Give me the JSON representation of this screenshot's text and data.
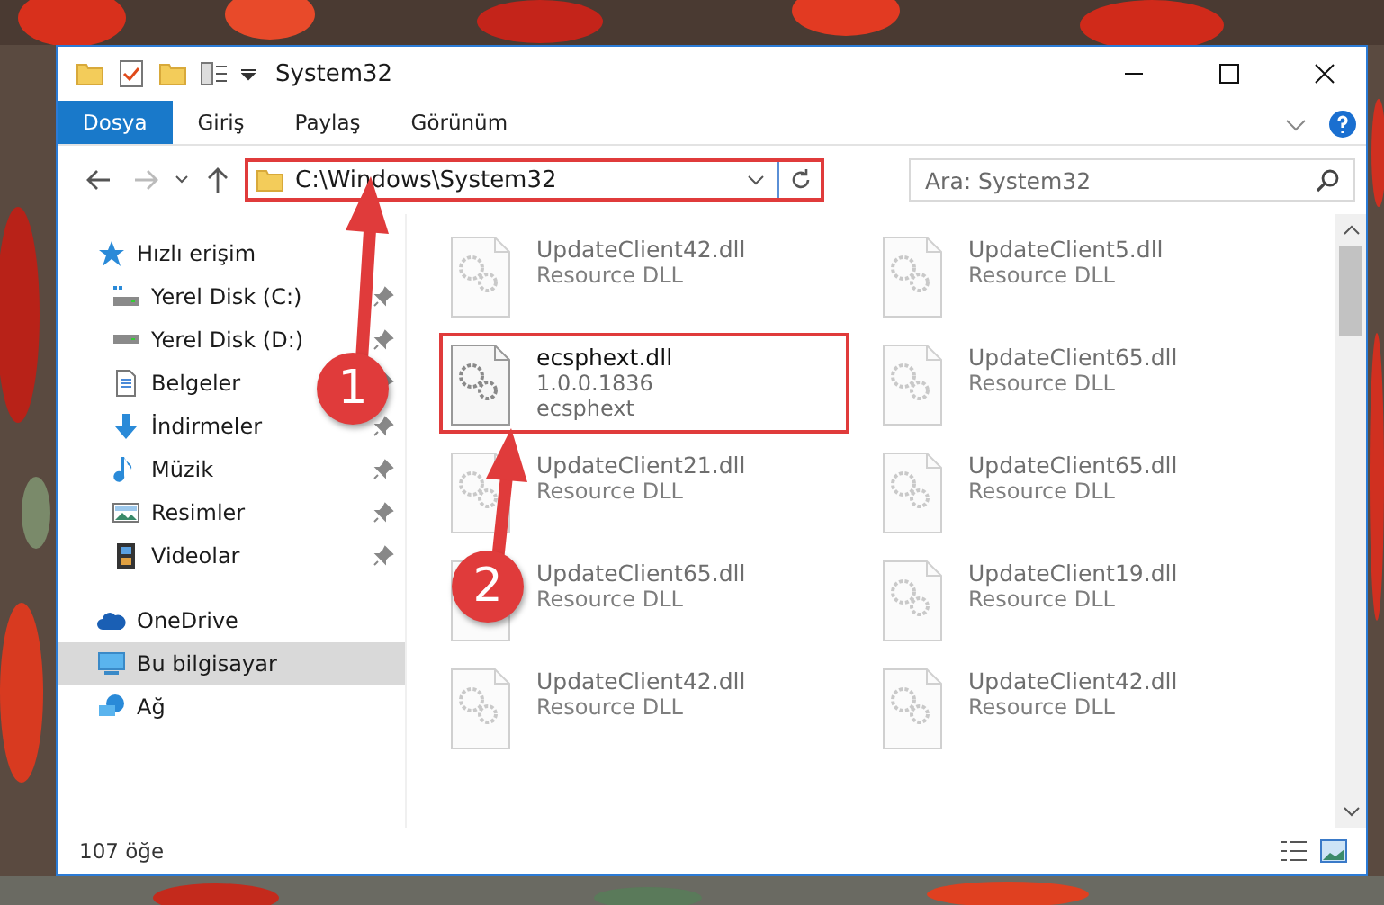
{
  "window": {
    "title": "System32"
  },
  "ribbon_tabs": [
    {
      "label": "Dosya",
      "selected": true
    },
    {
      "label": "Giriş",
      "selected": false
    },
    {
      "label": "Paylaş",
      "selected": false
    },
    {
      "label": "Görünüm",
      "selected": false
    }
  ],
  "address": {
    "path": "C:\\Windows\\System32",
    "highlighted": true
  },
  "search": {
    "placeholder": "Ara: System32"
  },
  "nav": [
    {
      "label": "Hızlı erişim",
      "kind": "star",
      "selected": false,
      "children": [
        {
          "label": "Yerel Disk (C:)",
          "kind": "disk-c",
          "selected": false,
          "pinned": true
        },
        {
          "label": "Yerel Disk (D:)",
          "kind": "disk",
          "selected": false,
          "pinned": true
        },
        {
          "label": "Belgeler",
          "kind": "docs",
          "selected": false,
          "pinned": true
        },
        {
          "label": "İndirmeler",
          "kind": "download",
          "selected": false,
          "pinned": true
        },
        {
          "label": "Müzik",
          "kind": "music",
          "selected": false,
          "pinned": true
        },
        {
          "label": "Resimler",
          "kind": "pictures",
          "selected": false,
          "pinned": true
        },
        {
          "label": "Videolar",
          "kind": "video",
          "selected": false,
          "pinned": true
        }
      ]
    },
    {
      "label": "OneDrive",
      "kind": "cloud",
      "selected": false
    },
    {
      "label": "Bu bilgisayar",
      "kind": "computer",
      "selected": true
    },
    {
      "label": "Ağ",
      "kind": "network",
      "selected": false
    }
  ],
  "files": [
    {
      "name": "UpdateClient42.dll",
      "details": [
        "Resource DLL"
      ],
      "blurred": true,
      "highlighted": false
    },
    {
      "name": "UpdateClient5.dll",
      "details": [
        "Resource DLL"
      ],
      "blurred": true,
      "highlighted": false
    },
    {
      "name": "ecsphext.dll",
      "details": [
        "1.0.0.1836",
        "ecsphext"
      ],
      "blurred": false,
      "highlighted": true
    },
    {
      "name": "UpdateClient65.dll",
      "details": [
        "Resource DLL"
      ],
      "blurred": true,
      "highlighted": false
    },
    {
      "name": "UpdateClient21.dll",
      "details": [
        "Resource DLL"
      ],
      "blurred": true,
      "highlighted": false
    },
    {
      "name": "UpdateClient65.dll",
      "details": [
        "Resource DLL"
      ],
      "blurred": true,
      "highlighted": false
    },
    {
      "name": "UpdateClient65.dll",
      "details": [
        "Resource DLL"
      ],
      "blurred": true,
      "highlighted": false
    },
    {
      "name": "UpdateClient19.dll",
      "details": [
        "Resource DLL"
      ],
      "blurred": true,
      "highlighted": false
    },
    {
      "name": "UpdateClient42.dll",
      "details": [
        "Resource DLL"
      ],
      "blurred": true,
      "highlighted": false
    },
    {
      "name": "UpdateClient42.dll",
      "details": [
        "Resource DLL"
      ],
      "blurred": true,
      "highlighted": false
    }
  ],
  "status_bar": {
    "count": "107 öğe"
  },
  "annotations": [
    {
      "number": "1"
    },
    {
      "number": "2"
    }
  ]
}
